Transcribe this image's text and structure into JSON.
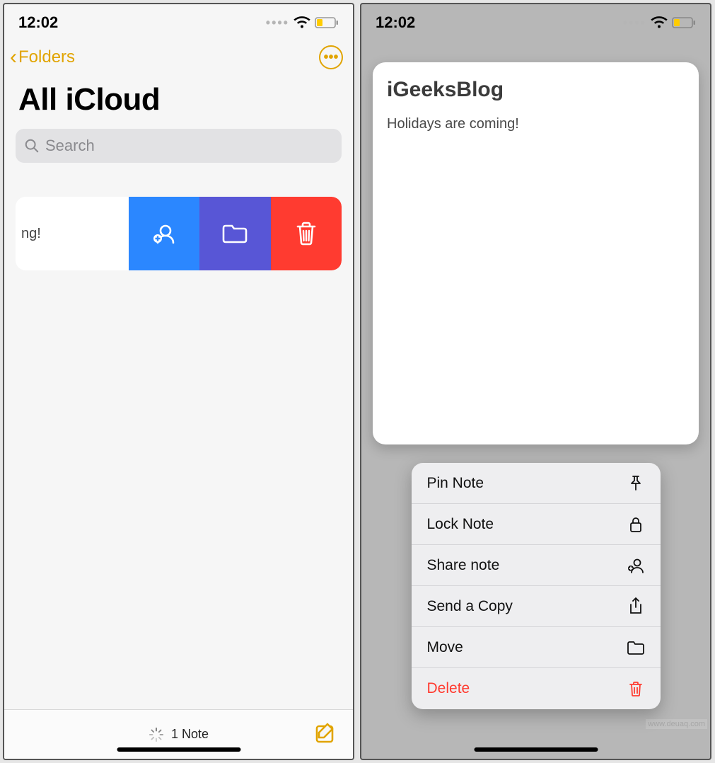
{
  "left": {
    "status": {
      "time": "12:02"
    },
    "nav": {
      "back_label": "Folders"
    },
    "title": "All iCloud",
    "search_placeholder": "Search",
    "note_row": {
      "partial_text": "ng!"
    },
    "footer": {
      "count": "1 Note"
    }
  },
  "right": {
    "status": {
      "time": "12:02"
    },
    "preview": {
      "title": "iGeeksBlog",
      "body": "Holidays are coming!"
    },
    "menu": {
      "pin": "Pin Note",
      "lock": "Lock Note",
      "share": "Share note",
      "send": "Send a Copy",
      "move": "Move",
      "delete": "Delete"
    }
  },
  "watermark": "www.deuaq.com"
}
